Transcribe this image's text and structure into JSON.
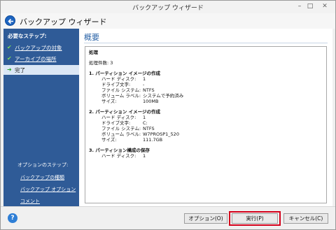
{
  "window": {
    "title": "バックアップ ウィザード",
    "min_glyph": "–",
    "max_glyph": "□",
    "close_glyph": "✕"
  },
  "header": {
    "title": "バックアップ ウィザード"
  },
  "sidebar": {
    "required_steps_label": "必要なステップ:",
    "items": [
      {
        "label": "バックアップの対象",
        "done": true
      },
      {
        "label": "アーカイブの場所",
        "done": true
      },
      {
        "label": "完了",
        "active": true
      }
    ],
    "check_glyph": "✔",
    "arrow_glyph": "➜",
    "option_steps_label": "オプションのステップ:",
    "option_links": [
      "バックアップの種類",
      "バックアップ オプション",
      "コメント"
    ]
  },
  "main": {
    "title": "概要",
    "summary": {
      "heading": "処理",
      "count_line": "処理件数: 3",
      "sections": [
        {
          "title": "1. パーティション イメージの作成",
          "rows": [
            {
              "k": "ハード ディスク:",
              "v": "1"
            },
            {
              "k": "ドライブ文字:",
              "v": "-"
            },
            {
              "k": "ファイル システム:",
              "v": "NTFS"
            },
            {
              "k": "ボリューム ラベル:",
              "v": "システムで予約済み"
            },
            {
              "k": "サイズ:",
              "v": "100MB"
            }
          ]
        },
        {
          "title": "2. パーティション イメージの作成",
          "rows": [
            {
              "k": "ハード ディスク:",
              "v": "1"
            },
            {
              "k": "ドライブ文字:",
              "v": "C:"
            },
            {
              "k": "ファイル システム:",
              "v": "NTFS"
            },
            {
              "k": "ボリューム ラベル:",
              "v": "W7PROSP1_520"
            },
            {
              "k": "サイズ:",
              "v": "111.7GB"
            }
          ]
        },
        {
          "title": "3. パーティション構成の保存",
          "rows": [
            {
              "k": "ハード ディスク:",
              "v": "1"
            }
          ]
        }
      ]
    }
  },
  "footer": {
    "help_glyph": "?",
    "options_button": "オプション(O)",
    "run_button": "実行(P)",
    "cancel_button": "キャンセル(C)"
  },
  "colors": {
    "sidebar": "#2f5b97",
    "title_blue": "#2b64a8",
    "highlight_red": "#d4001a"
  }
}
